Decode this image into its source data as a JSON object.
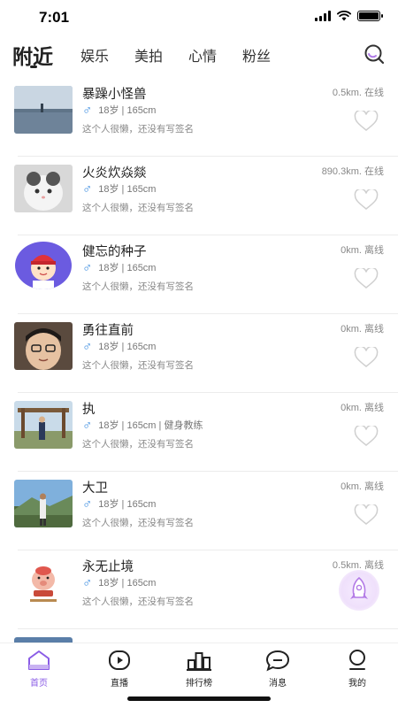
{
  "status_bar": {
    "time": "7:01"
  },
  "tabs": [
    {
      "label": "附近",
      "active": true
    },
    {
      "label": "娱乐"
    },
    {
      "label": "美拍"
    },
    {
      "label": "心情"
    },
    {
      "label": "粉丝"
    }
  ],
  "users": [
    {
      "name": "暴躁小怪兽",
      "info": "18岁 | 165cm",
      "signature": "这个人很懒，还没有写签名",
      "distance": "0.5km. 在线",
      "avatar": "sky-photo"
    },
    {
      "name": "火炎炊焱燚",
      "info": "18岁 | 165cm",
      "signature": "这个人很懒，还没有写签名",
      "distance": "890.3km. 在线",
      "avatar": "cat-photo"
    },
    {
      "name": "健忘的种子",
      "info": "18岁 | 165cm",
      "signature": "这个人很懒，还没有写签名",
      "distance": "0km. 离线",
      "avatar": "cartoon-boy"
    },
    {
      "name": "勇往直前",
      "info": "18岁 | 165cm",
      "signature": "这个人很懒，还没有写签名",
      "distance": "0km. 离线",
      "avatar": "child-photo"
    },
    {
      "name": "执",
      "info": "18岁 | 165cm | 健身教练",
      "signature": "这个人很懒，还没有写签名",
      "distance": "0km. 离线",
      "avatar": "outdoor-photo"
    },
    {
      "name": "大卫",
      "info": "18岁 | 165cm",
      "signature": "这个人很懒，还没有写签名",
      "distance": "0km. 离线",
      "avatar": "hill-photo"
    },
    {
      "name": "永无止境",
      "info": "18岁 | 165cm",
      "signature": "这个人很懒，还没有写签名",
      "distance": "0.5km. 离线",
      "avatar": "cartoon-pig"
    }
  ],
  "bottom_nav": [
    {
      "label": "首页",
      "icon": "home-icon",
      "active": true
    },
    {
      "label": "直播",
      "icon": "live-icon"
    },
    {
      "label": "排行榜",
      "icon": "ranking-icon"
    },
    {
      "label": "消息",
      "icon": "message-icon"
    },
    {
      "label": "我的",
      "icon": "profile-icon"
    }
  ],
  "colors": {
    "accent": "#8a5ce6",
    "male": "#3b8de0"
  }
}
